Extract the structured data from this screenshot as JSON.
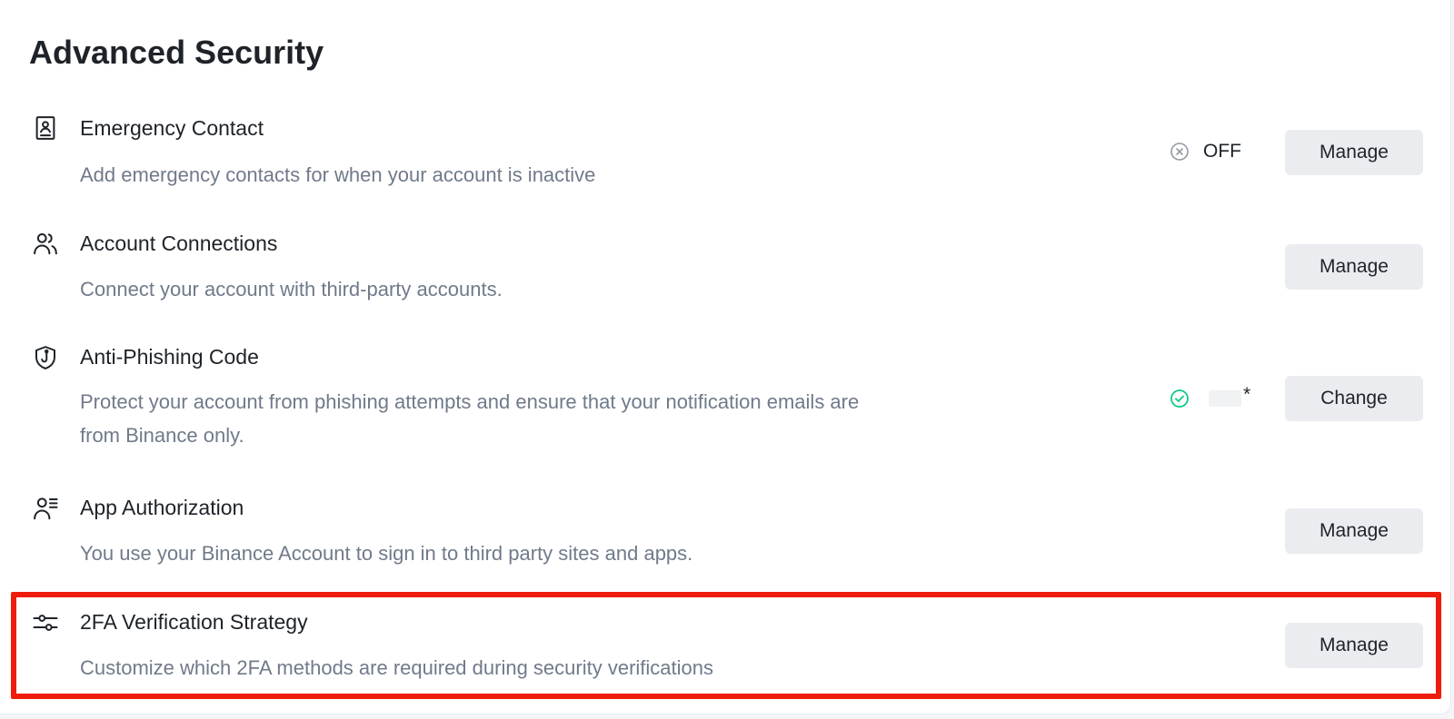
{
  "page": {
    "title": "Advanced Security"
  },
  "rows": [
    {
      "icon": "contact-card-icon",
      "title": "Emergency Contact",
      "desc": "Add emergency contacts for when your account is inactive",
      "status": {
        "icon": "x-circle-icon",
        "text": "OFF"
      },
      "button": "Manage"
    },
    {
      "icon": "users-icon",
      "title": "Account Connections",
      "desc": "Connect your account with third-party accounts.",
      "button": "Manage"
    },
    {
      "icon": "shield-hook-icon",
      "title": "Anti-Phishing Code",
      "desc": "Protect your account from phishing attempts and ensure that your notification emails are from Binance only.",
      "status": {
        "icon": "check-circle-icon",
        "text": "*"
      },
      "button": "Change"
    },
    {
      "icon": "user-list-icon",
      "title": "App Authorization",
      "desc": "You use your Binance Account to sign in to third party sites and apps.",
      "button": "Manage"
    },
    {
      "icon": "sliders-icon",
      "title": "2FA Verification Strategy",
      "desc": "Customize which 2FA methods are required during security verifications",
      "button": "Manage"
    }
  ],
  "colors": {
    "text_primary": "#1e2329",
    "text_secondary": "#707a8a",
    "button_bg": "#eaecef",
    "status_off": "#929aa5",
    "status_on": "#0ecb81",
    "highlight": "#ee1c0c"
  }
}
